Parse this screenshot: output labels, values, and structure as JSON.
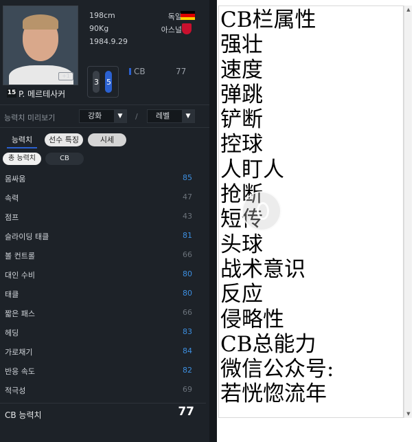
{
  "player": {
    "number": "15",
    "name": "P. 메르테사커",
    "height": "198cm",
    "weight": "90Kg",
    "birth": "1984.9.29",
    "nation": "독일",
    "club": "아스널",
    "boost_label": "+1",
    "weak_foot_left": "3",
    "weak_foot_right": "5",
    "position": "CB",
    "position_ovr": "77"
  },
  "preview": {
    "label": "능력치 미리보기",
    "enhance": "강화",
    "level": "레벨",
    "separator": "/"
  },
  "tabs": [
    "능력치",
    "선수 특징",
    "시세"
  ],
  "chips": [
    "총 능력치",
    "CB"
  ],
  "stats": [
    {
      "name": "몸싸움",
      "value": "85",
      "hl": true
    },
    {
      "name": "속력",
      "value": "47",
      "hl": false
    },
    {
      "name": "점프",
      "value": "43",
      "hl": false
    },
    {
      "name": "슬라이딩 태클",
      "value": "81",
      "hl": true
    },
    {
      "name": "볼 컨트롤",
      "value": "66",
      "hl": false
    },
    {
      "name": "대인 수비",
      "value": "80",
      "hl": true
    },
    {
      "name": "태클",
      "value": "80",
      "hl": true
    },
    {
      "name": "짧은 패스",
      "value": "66",
      "hl": false
    },
    {
      "name": "헤딩",
      "value": "83",
      "hl": true
    },
    {
      "name": "가로채기",
      "value": "84",
      "hl": true
    },
    {
      "name": "반응 속도",
      "value": "82",
      "hl": true
    },
    {
      "name": "적극성",
      "value": "69",
      "hl": false
    }
  ],
  "total": {
    "label": "CB 능력치",
    "value": "77"
  },
  "note_lines": [
    "CB栏属性",
    "强壮",
    "速度",
    "弹跳",
    "铲断",
    "控球",
    "人盯人",
    "抢断",
    "短传",
    "头球",
    "战术意识",
    "反应",
    "侵略性",
    "CB总能力",
    "微信公众号:",
    "若恍惚流年"
  ],
  "colors": {
    "panel_bg": "#1d2228",
    "highlight_value": "#3d8fe0",
    "dim_value": "#6c737b",
    "position_accent": "#2b61d1"
  }
}
